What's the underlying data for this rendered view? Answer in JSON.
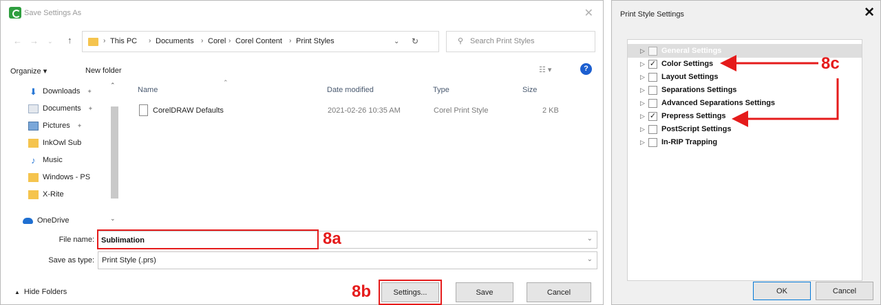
{
  "save_dialog": {
    "title": "Save Settings As",
    "address": {
      "crumbs": [
        "This PC",
        "Documents",
        "Corel",
        "Corel Content",
        "Print Styles"
      ]
    },
    "search_placeholder": "Search Print Styles",
    "toolbar": {
      "organize_label": "Organize ▾",
      "new_folder_label": "New folder"
    },
    "nav_items": [
      {
        "label": "Downloads",
        "icon": "download-icon",
        "pinned": true
      },
      {
        "label": "Documents",
        "icon": "documents-icon",
        "pinned": true
      },
      {
        "label": "Pictures",
        "icon": "pictures-icon",
        "pinned": true
      },
      {
        "label": "InkOwl Sub",
        "icon": "folder-icon",
        "pinned": false
      },
      {
        "label": "Music",
        "icon": "music-icon",
        "pinned": false
      },
      {
        "label": "Windows - PS",
        "icon": "folder-icon",
        "pinned": false
      },
      {
        "label": "X-Rite",
        "icon": "folder-icon",
        "pinned": false
      },
      {
        "label": "OneDrive",
        "icon": "onedrive-icon",
        "pinned": false
      }
    ],
    "columns": [
      "Name",
      "Date modified",
      "Type",
      "Size"
    ],
    "files": [
      {
        "name": "CorelDRAW Defaults",
        "date": "2021-02-26 10:35 AM",
        "type": "Corel Print Style",
        "size": "2 KB"
      }
    ],
    "file_name_label": "File name:",
    "file_name_value": "Sublimation",
    "save_type_label": "Save as type:",
    "save_type_value": "Print Style (.prs)",
    "hide_folders_label": "Hide Folders",
    "settings_button": "Settings...",
    "save_button": "Save",
    "cancel_button": "Cancel"
  },
  "print_style_dialog": {
    "title": "Print Style Settings",
    "tree_items": [
      {
        "label": "General Settings",
        "checked": false,
        "selected": true
      },
      {
        "label": "Color Settings",
        "checked": true,
        "selected": false
      },
      {
        "label": "Layout Settings",
        "checked": false,
        "selected": false
      },
      {
        "label": "Separations Settings",
        "checked": false,
        "selected": false
      },
      {
        "label": "Advanced Separations Settings",
        "checked": false,
        "selected": false
      },
      {
        "label": "Prepress Settings",
        "checked": true,
        "selected": false
      },
      {
        "label": "PostScript Settings",
        "checked": false,
        "selected": false
      },
      {
        "label": "In-RIP Trapping",
        "checked": false,
        "selected": false
      }
    ],
    "ok_button": "OK",
    "cancel_button": "Cancel"
  },
  "annotations": {
    "a": "8a",
    "b": "8b",
    "c": "8c"
  },
  "colors": {
    "annotation_red": "#e51b1b",
    "accent_blue": "#0078d7",
    "folder_yellow": "#f5c44e"
  }
}
